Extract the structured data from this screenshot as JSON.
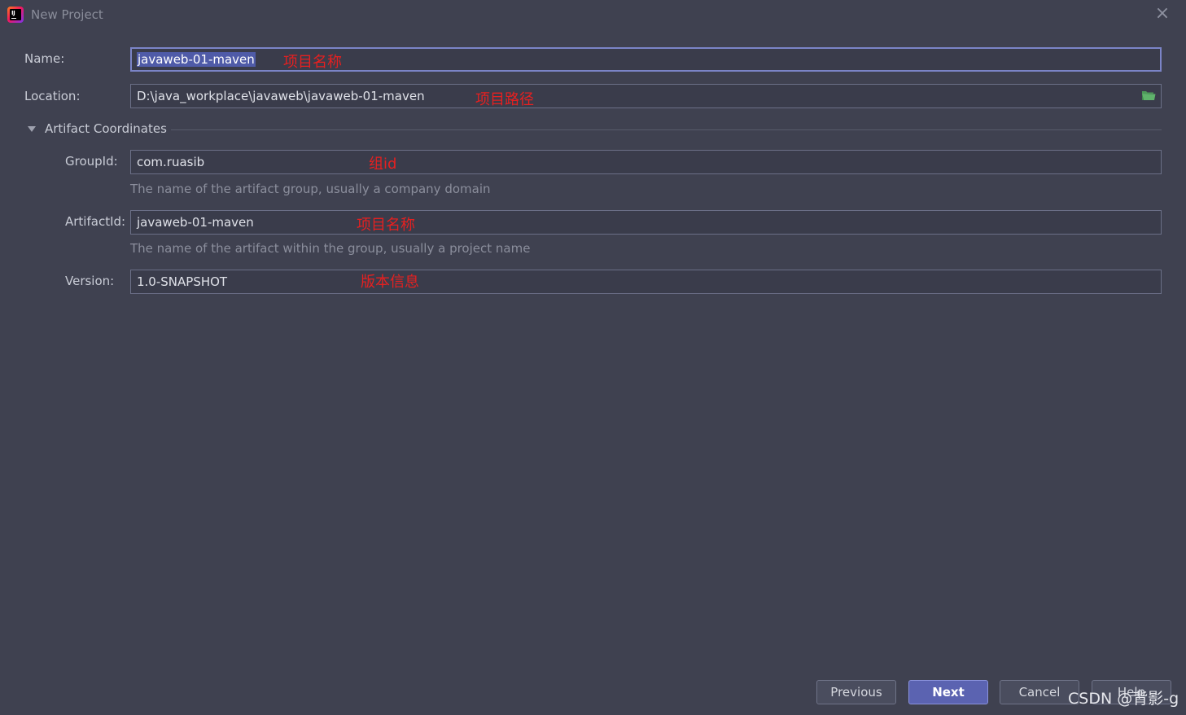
{
  "window": {
    "title": "New Project",
    "close_glyph": "×"
  },
  "form": {
    "name": {
      "label": "Name:",
      "value": "javaweb-01-maven",
      "annotation": "项目名称"
    },
    "location": {
      "label": "Location:",
      "value": "D:\\java_workplace\\javaweb\\javaweb-01-maven",
      "annotation": "项目路径",
      "browse_icon": "folder-open-icon"
    },
    "section": {
      "title": "Artifact Coordinates",
      "expanded": true
    },
    "group_id": {
      "label": "GroupId:",
      "value": "com.ruasib",
      "annotation": "组id",
      "hint": "The name of the artifact group, usually a company domain"
    },
    "artifact_id": {
      "label": "ArtifactId:",
      "value": "javaweb-01-maven",
      "annotation": "项目名称",
      "hint": "The name of the artifact within the group, usually a project name"
    },
    "version": {
      "label": "Version:",
      "value": "1.0-SNAPSHOT",
      "annotation": "版本信息"
    }
  },
  "buttons": {
    "previous": "Previous",
    "next": "Next",
    "cancel": "Cancel",
    "help": "Help"
  },
  "watermark": "CSDN @背影-g",
  "colors": {
    "background": "#3f4150",
    "annotation": "#e62020",
    "primary_button": "#5b63b1",
    "selection": "#4f5ba8"
  }
}
